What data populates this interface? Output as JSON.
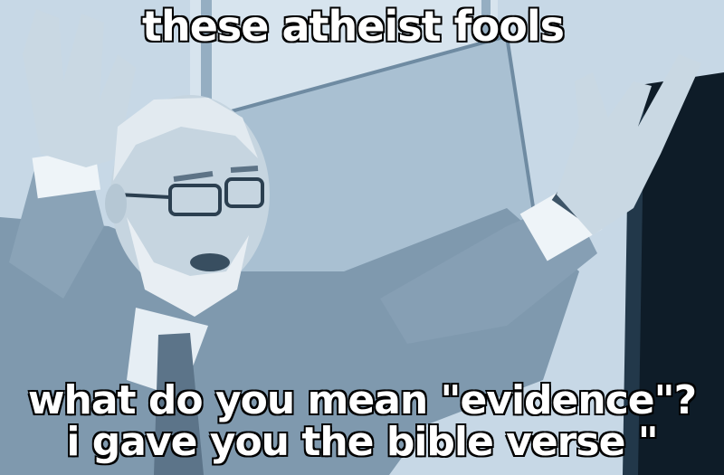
{
  "meme": {
    "top_text": "these atheist fools",
    "bottom_lines": [
      "what do you mean \"evidence\"?",
      "i gave you the bible verse \""
    ]
  },
  "palette": {
    "tint": "#9fbad0",
    "suit": "#7e98ad",
    "skin": "#c8d7e2",
    "monitor": "#101f2c",
    "text": "#ffffff",
    "outline": "#000000"
  }
}
